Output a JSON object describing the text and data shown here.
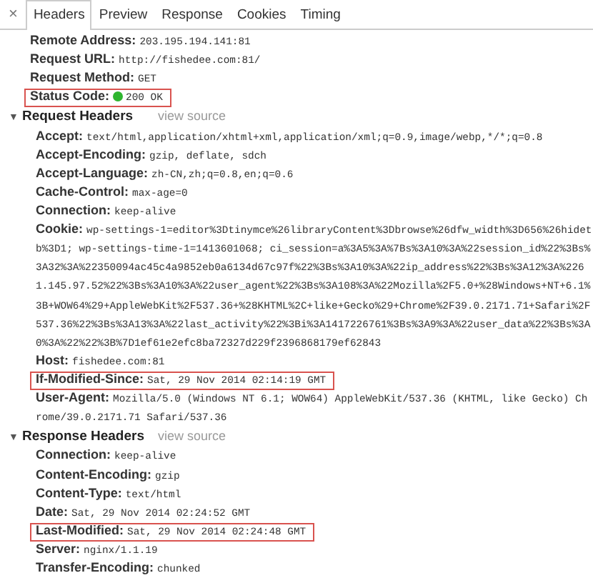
{
  "close": "×",
  "tabs": [
    {
      "label": "Headers",
      "selected": true
    },
    {
      "label": "Preview",
      "selected": false
    },
    {
      "label": "Response",
      "selected": false
    },
    {
      "label": "Cookies",
      "selected": false
    },
    {
      "label": "Timing",
      "selected": false
    }
  ],
  "general": [
    {
      "name": "Remote Address:",
      "value": "203.195.194.141:81",
      "highlighted": false
    },
    {
      "name": "Request URL:",
      "value": "http://fishedee.com:81/",
      "highlighted": false
    },
    {
      "name": "Request Method:",
      "value": "GET",
      "highlighted": false
    },
    {
      "name": "Status Code:",
      "value": "200 OK",
      "highlighted": true,
      "color": "#2fb52f"
    }
  ],
  "sections": [
    {
      "arrow": "▼",
      "title": "Request Headers",
      "expanded": true,
      "link": "view source",
      "headers": [
        {
          "name": "Accept:",
          "value": "text/html,application/xhtml+xml,application/xml;q=0.9,image/webp,*/*;q=0.8",
          "highlighted": false
        },
        {
          "name": "Accept-Encoding:",
          "value": "gzip, deflate, sdch",
          "highlighted": false
        },
        {
          "name": "Accept-Language:",
          "value": "zh-CN,zh;q=0.8,en;q=0.6",
          "highlighted": false
        },
        {
          "name": "Cache-Control:",
          "value": "max-age=0",
          "highlighted": false
        },
        {
          "name": "Connection:",
          "value": "keep-alive",
          "highlighted": false
        },
        {
          "name": "Cookie:",
          "value": "wp-settings-1=editor%3Dtinymce%26libraryContent%3Dbrowse%26dfw_width%3D656%26hidetb%3D1; wp-settings-time-1=1413601068; ci_session=a%3A5%3A%7Bs%3A10%3A%22session_id%22%3Bs%3A32%3A%22350094ac45c4a9852eb0a6134d67c97f%22%3Bs%3A10%3A%22ip_address%22%3Bs%3A12%3A%2261.145.97.52%22%3Bs%3A10%3A%22user_agent%22%3Bs%3A108%3A%22Mozilla%2F5.0+%28Windows+NT+6.1%3B+WOW64%29+AppleWebKit%2F537.36+%28KHTML%2C+like+Gecko%29+Chrome%2F39.0.2171.71+Safari%2F537.36%22%3Bs%3A13%3A%22last_activity%22%3Bi%3A1417226761%3Bs%3A9%3A%22user_data%22%3Bs%3A0%3A%22%22%3B%7D1ef61e2efc8ba72327d229f2396868179ef62843",
          "highlighted": false
        },
        {
          "name": "Host:",
          "value": "fishedee.com:81",
          "highlighted": false
        },
        {
          "name": "If-Modified-Since:",
          "value": "Sat, 29 Nov 2014 02:14:19 GMT",
          "highlighted": true
        },
        {
          "name": "User-Agent:",
          "value": "Mozilla/5.0 (Windows NT 6.1; WOW64) AppleWebKit/537.36 (KHTML, like Gecko) Chrome/39.0.2171.71 Safari/537.36",
          "highlighted": false
        }
      ]
    },
    {
      "arrow": "▼",
      "title": "Response Headers",
      "expanded": true,
      "link": "view source",
      "headers": [
        {
          "name": "Connection:",
          "value": "keep-alive",
          "highlighted": false
        },
        {
          "name": "Content-Encoding:",
          "value": "gzip",
          "highlighted": false
        },
        {
          "name": "Content-Type:",
          "value": "text/html",
          "highlighted": false
        },
        {
          "name": "Date:",
          "value": "Sat, 29 Nov 2014 02:24:52 GMT",
          "highlighted": false
        },
        {
          "name": "Last-Modified:",
          "value": "Sat, 29 Nov 2014 02:24:48 GMT",
          "highlighted": true
        },
        {
          "name": "Server:",
          "value": "nginx/1.1.19",
          "highlighted": false
        },
        {
          "name": "Transfer-Encoding:",
          "value": "chunked",
          "highlighted": false
        }
      ]
    }
  ]
}
